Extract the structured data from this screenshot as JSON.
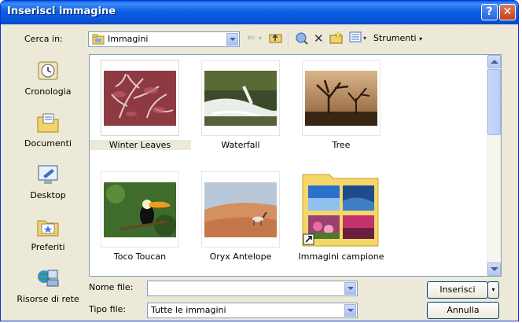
{
  "window": {
    "title": "Inserisci immagine"
  },
  "toolbar": {
    "look_in_label": "Cerca in:",
    "look_in_value": "Immagini",
    "tools_label": "Strumenti"
  },
  "places": [
    {
      "name": "places-history",
      "label": "Cronologia",
      "icon": "history-icon"
    },
    {
      "name": "places-documents",
      "label": "Documenti",
      "icon": "documents-folder-icon"
    },
    {
      "name": "places-desktop",
      "label": "Desktop",
      "icon": "desktop-icon"
    },
    {
      "name": "places-favorites",
      "label": "Preferiti",
      "icon": "favorites-folder-icon"
    },
    {
      "name": "places-network",
      "label": "Risorse di rete",
      "icon": "network-icon"
    }
  ],
  "files": [
    {
      "label": "Winter Leaves",
      "selected": true
    },
    {
      "label": "Waterfall",
      "selected": false
    },
    {
      "label": "Tree",
      "selected": false
    },
    {
      "label": "Toco Toucan",
      "selected": false
    },
    {
      "label": "Oryx Antelope",
      "selected": false
    },
    {
      "label": "Immagini campione",
      "selected": false
    }
  ],
  "form": {
    "filename_label": "Nome file:",
    "filename_value": "",
    "filetype_label": "Tipo file:",
    "filetype_value": "Tutte le immagini"
  },
  "buttons": {
    "insert": "Inserisci",
    "cancel": "Annulla"
  }
}
